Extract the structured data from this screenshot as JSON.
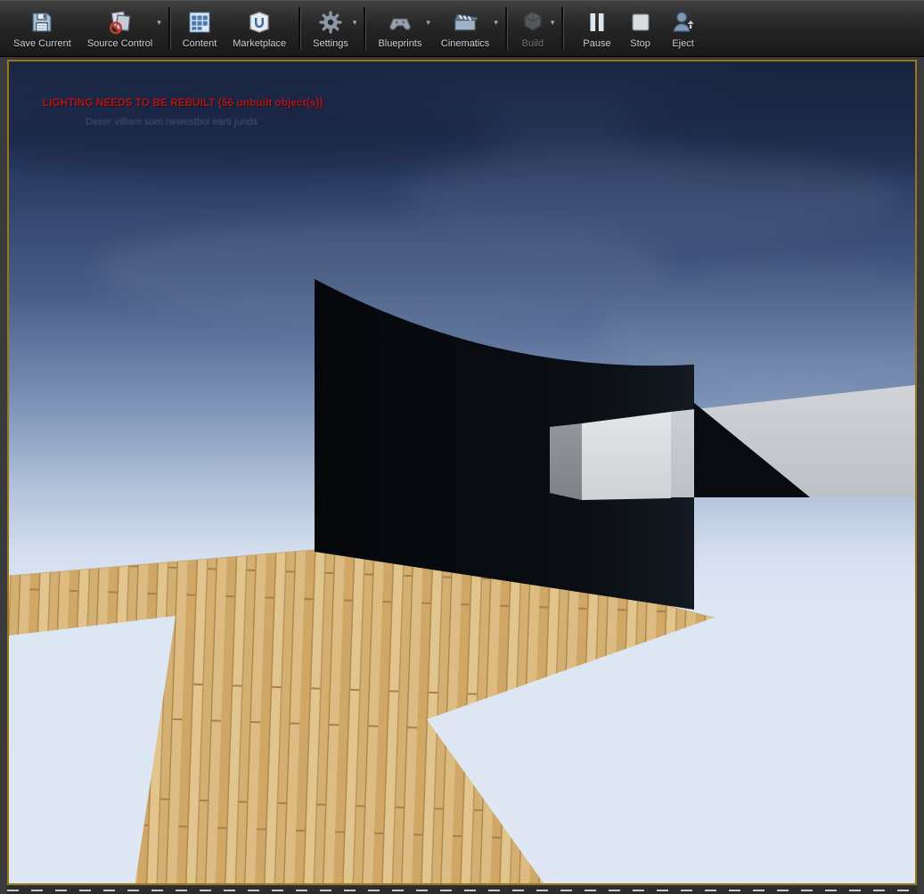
{
  "toolbar": {
    "buttons": [
      {
        "label": "Save Current",
        "icon": "save-icon",
        "dropdown": false,
        "enabled": true
      },
      {
        "label": "Source Control",
        "icon": "source-control-icon",
        "dropdown": true,
        "enabled": true
      },
      {
        "label": "Content",
        "icon": "content-browser-icon",
        "dropdown": false,
        "enabled": true
      },
      {
        "label": "Marketplace",
        "icon": "marketplace-icon",
        "dropdown": false,
        "enabled": true
      },
      {
        "label": "Settings",
        "icon": "settings-gear-icon",
        "dropdown": true,
        "enabled": true
      },
      {
        "label": "Blueprints",
        "icon": "blueprints-icon",
        "dropdown": true,
        "enabled": true
      },
      {
        "label": "Cinematics",
        "icon": "cinematics-icon",
        "dropdown": true,
        "enabled": true
      },
      {
        "label": "Build",
        "icon": "build-icon",
        "dropdown": true,
        "enabled": false
      },
      {
        "label": "Pause",
        "icon": "pause-icon",
        "dropdown": false,
        "enabled": true
      },
      {
        "label": "Stop",
        "icon": "stop-icon",
        "dropdown": false,
        "enabled": true
      },
      {
        "label": "Eject",
        "icon": "eject-icon",
        "dropdown": false,
        "enabled": true
      }
    ]
  },
  "viewport": {
    "lighting_warning": "LIGHTING NEEDS TO BE REBUILT (56 unbuilt object(s))",
    "faded_message": "Deser villiam som newestbol earti junds"
  },
  "colors": {
    "warning-red": "#b51414",
    "pie-border-gold": "#96761f",
    "toolbar-label": "#cdd0d3",
    "sky-top": "#1a2540",
    "sky-horizon": "#dee7f3",
    "wood-base": "#d9b87e",
    "wall-black": "#090c10",
    "beam-gray": "#c9ced4"
  }
}
